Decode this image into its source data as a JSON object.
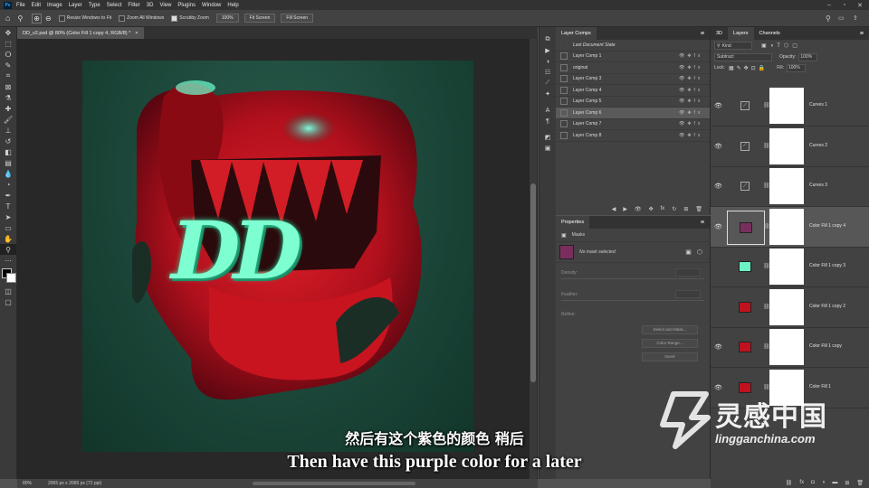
{
  "menu": {
    "app_icon": "Ps",
    "items": [
      "File",
      "Edit",
      "Image",
      "Layer",
      "Type",
      "Select",
      "Filter",
      "3D",
      "View",
      "Plugins",
      "Window",
      "Help"
    ],
    "window_controls": [
      "minimize-icon",
      "restore-icon",
      "close-icon"
    ]
  },
  "options": {
    "resize_windows": "Resize Windows to Fit",
    "zoom_all": "Zoom All Windows",
    "scrubby_zoom": "Scrubby Zoom",
    "zoom_100": "100%",
    "fit_screen": "Fit Screen",
    "fill_screen": "Fill Screen"
  },
  "document": {
    "tab_title": "DD_v2.psd @ 80% (Color Fill 1 copy 4, RGB/8) *",
    "tab_close": "×",
    "art_text": "DD",
    "zoom": "80%",
    "size": "2065 px x 2065 px (72 ppi)"
  },
  "layer_comps": {
    "tab": "Layer Comps",
    "last_state": "Last Document State",
    "items": [
      "Layer Comp 1",
      "original",
      "Layer Comp 3",
      "Layer Comp 4",
      "Layer Comp 5",
      "Layer Comp 6",
      "Layer Comp 7",
      "Layer Comp 8"
    ],
    "selected_index": 5
  },
  "properties": {
    "tab": "Properties",
    "masks_label": "Masks",
    "no_mask": "No mask selected",
    "density": "Density:",
    "feather": "Feather:",
    "refine": "Refine:",
    "select_mask": "Select and Mask...",
    "color_range": "Color Range...",
    "invert": "Invert"
  },
  "layers": {
    "tabs": [
      "3D",
      "Layers",
      "Channels"
    ],
    "active_tab": "Layers",
    "kind": "Kind",
    "blend": "Subtract",
    "opacity_label": "Opacity:",
    "opacity": "100%",
    "lock_label": "Lock:",
    "fill_label": "Fill:",
    "fill": "100%",
    "rows": [
      {
        "name": "Curves 1",
        "type": "curves",
        "visible": true
      },
      {
        "name": "Curves 2",
        "type": "curves",
        "visible": true
      },
      {
        "name": "Curves 3",
        "type": "curves",
        "visible": true
      },
      {
        "name": "Color Fill 1 copy 4",
        "type": "fill",
        "color": "#7a2e5e",
        "visible": true,
        "selected": true
      },
      {
        "name": "Color Fill 1 copy 3",
        "type": "fill",
        "color": "#6cf3c4",
        "visible": false
      },
      {
        "name": "Color Fill 1 copy 2",
        "type": "fill",
        "color": "#c0121e",
        "visible": false
      },
      {
        "name": "Color Fill 1 copy",
        "type": "fill",
        "color": "#c0121e",
        "visible": true
      },
      {
        "name": "Color Fill 1",
        "type": "fill",
        "color": "#c0121e",
        "visible": true
      }
    ]
  },
  "subtitles": {
    "cn": "然后有这个紫色的颜色 稍后",
    "en": "Then have this purple color for a later"
  },
  "watermark": {
    "cn": "灵感中国",
    "url": "lingganchina.com"
  }
}
